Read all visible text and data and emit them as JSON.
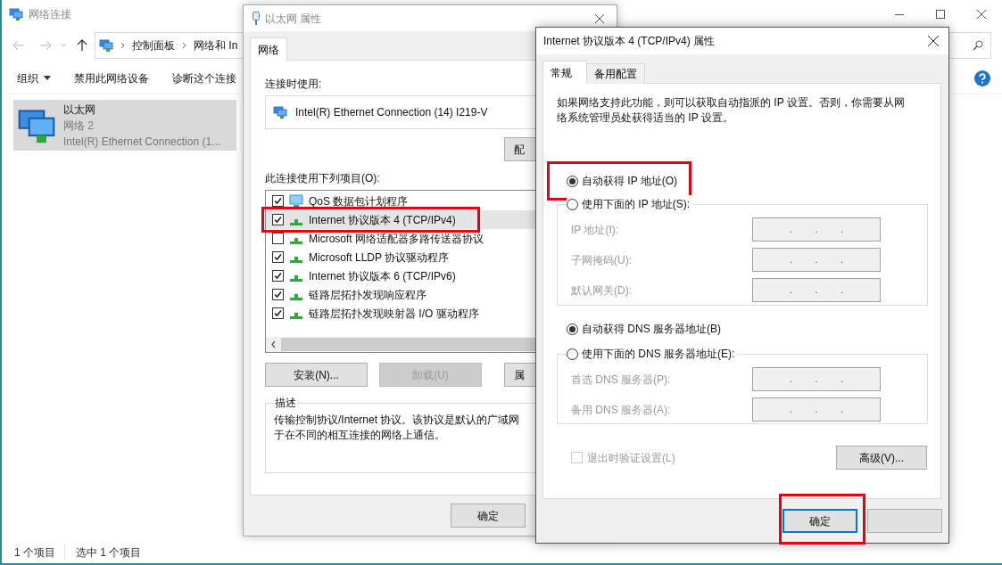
{
  "explorer": {
    "title": "网络连接",
    "breadcrumb": [
      "控制面板",
      "网络和 In"
    ],
    "toolbar": [
      {
        "label": "组织",
        "dropdown": true
      },
      {
        "label": "禁用此网络设备",
        "dropdown": false
      },
      {
        "label": "诊断这个连接",
        "dropdown": false
      }
    ],
    "items": [
      {
        "name": "以太网",
        "network": "网络 2",
        "adapter": "Intel(R) Ethernet Connection (1...",
        "selected": true
      }
    ],
    "status_bar": [
      "1 个项目",
      "选中 1 个项目"
    ]
  },
  "ethernet_dialog": {
    "title": "以太网 属性",
    "tabs": [
      {
        "label": "网络",
        "selected": true
      }
    ],
    "connect_using_label": "连接时使用:",
    "adapter": "Intel(R) Ethernet Connection (14) I219-V",
    "configure_button": "配",
    "items_label": "此连接使用下列项目(O):",
    "items": [
      {
        "label": "QoS 数据包计划程序",
        "kind": "service",
        "checked": true,
        "selected": false,
        "highlighted": false
      },
      {
        "label": "Internet 协议版本 4 (TCP/IPv4)",
        "kind": "protocol",
        "checked": true,
        "selected": true,
        "highlighted": true
      },
      {
        "label": "Microsoft 网络适配器多路传送器协议",
        "kind": "protocol",
        "checked": false,
        "selected": false,
        "highlighted": false
      },
      {
        "label": "Microsoft LLDP 协议驱动程序",
        "kind": "protocol",
        "checked": true,
        "selected": false,
        "highlighted": false
      },
      {
        "label": "Internet 协议版本 6 (TCP/IPv6)",
        "kind": "protocol",
        "checked": true,
        "selected": false,
        "highlighted": false
      },
      {
        "label": "链路层拓扑发现响应程序",
        "kind": "protocol",
        "checked": true,
        "selected": false,
        "highlighted": false
      },
      {
        "label": "链路层拓扑发现映射器 I/O 驱动程序",
        "kind": "protocol",
        "checked": true,
        "selected": false,
        "highlighted": false
      }
    ],
    "buttons": [
      {
        "label": "安装(N)...",
        "disabled": false
      },
      {
        "label": "卸载(U)",
        "disabled": true
      },
      {
        "label": "属",
        "disabled": false
      }
    ],
    "description": {
      "legend": "描述",
      "lines": [
        "传输控制协议/Internet 协议。该协议是默认的广域网",
        "于在不同的相互连接的网络上通信。"
      ]
    },
    "footer_buttons": [
      "确定"
    ]
  },
  "ipv4_dialog": {
    "title": "Internet 协议版本 4 (TCP/IPv4) 属性",
    "tabs": [
      {
        "label": "常规",
        "selected": true
      },
      {
        "label": "备用配置",
        "selected": false
      }
    ],
    "intro": "如果网络支持此功能，则可以获取自动指派的 IP 设置。否则，你需要从网络系统管理员处获得适当的 IP 设置。",
    "ip_mode": [
      {
        "label": "自动获得 IP 地址(O)",
        "selected": true,
        "highlighted": true
      },
      {
        "label": "使用下面的 IP 地址(S):",
        "selected": false,
        "highlighted": false
      }
    ],
    "ip_fields": [
      {
        "label": "IP 地址(I):",
        "disabled": true,
        "separators": [
          ".",
          ".",
          "."
        ]
      },
      {
        "label": "子网掩码(U):",
        "disabled": true,
        "separators": [
          ".",
          ".",
          "."
        ]
      },
      {
        "label": "默认网关(D):",
        "disabled": true,
        "separators": [
          ".",
          ".",
          "."
        ]
      }
    ],
    "dns_mode": [
      {
        "label": "自动获得 DNS 服务器地址(B)",
        "selected": true,
        "highlighted": false
      },
      {
        "label": "使用下面的 DNS 服务器地址(E):",
        "selected": false,
        "highlighted": false
      }
    ],
    "dns_fields": [
      {
        "label": "首选 DNS 服务器(P):",
        "disabled": true,
        "separators": [
          ".",
          ".",
          "."
        ]
      },
      {
        "label": "备用 DNS 服务器(A):",
        "disabled": true,
        "separators": [
          ".",
          ".",
          "."
        ]
      }
    ],
    "validate": {
      "label": "退出时验证设置(L)",
      "checked": false,
      "disabled": true
    },
    "advanced_button": "高级(V)...",
    "footer_buttons": [
      {
        "label": "确定",
        "focused": true,
        "highlighted": true
      },
      {
        "focused": false,
        "highlighted": false
      }
    ]
  }
}
